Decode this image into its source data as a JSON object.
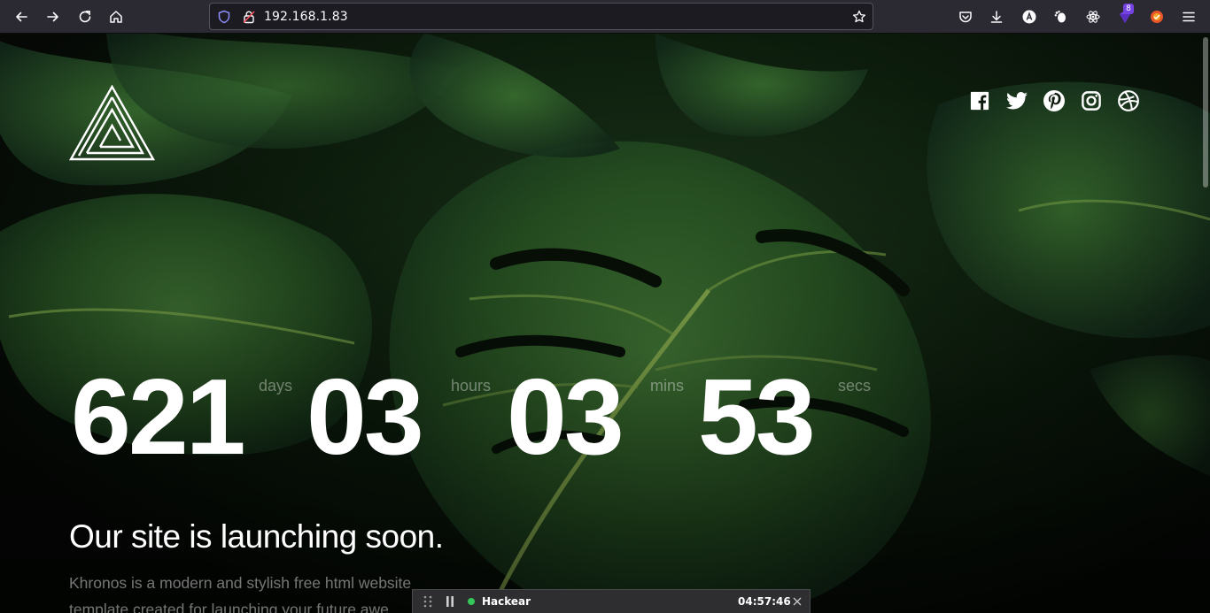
{
  "browser": {
    "url": "192.168.1.83",
    "extension_badge_count": "8",
    "icons": {
      "back": "arrow-left-icon",
      "forward": "arrow-right-icon",
      "reload": "reload-icon",
      "home": "home-icon",
      "tracking": "shield-icon",
      "connection": "insecure-lock-icon",
      "bookmark": "star-icon",
      "pocket": "pocket-icon",
      "downloads": "download-icon",
      "menu": "hamburger-menu-icon"
    }
  },
  "page": {
    "social": [
      "facebook-icon",
      "twitter-icon",
      "pinterest-icon",
      "instagram-icon",
      "dribbble-icon"
    ],
    "countdown": [
      {
        "value": "621",
        "unit": "days"
      },
      {
        "value": "03",
        "unit": "hours"
      },
      {
        "value": "03",
        "unit": "mins"
      },
      {
        "value": "53",
        "unit": "secs"
      }
    ],
    "headline": "Our site is launching soon.",
    "subtext": "Khronos is a modern and stylish free html website template created for launching your future awe"
  },
  "recorder": {
    "name": "Hackear",
    "time": "04:57:46",
    "status_color": "#34c759"
  }
}
